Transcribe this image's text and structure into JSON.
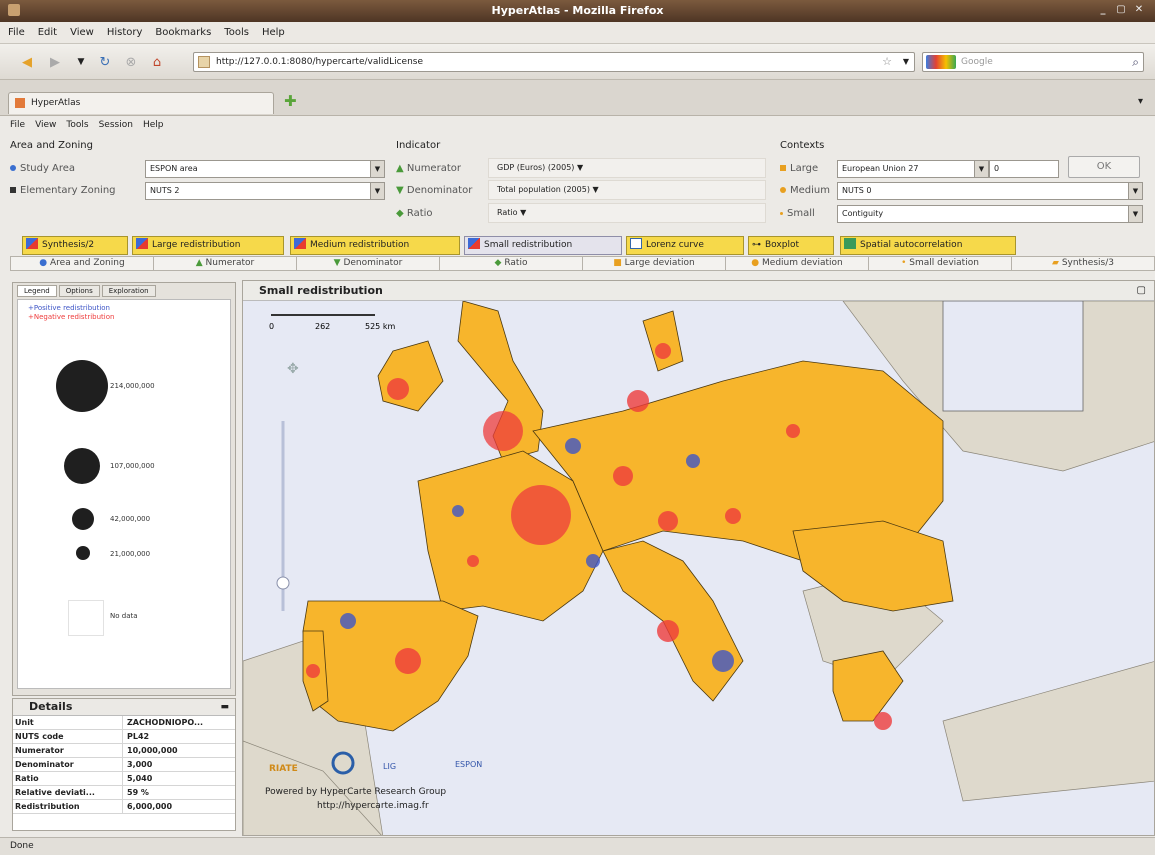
{
  "window": {
    "title": "HyperAtlas - Mozilla Firefox"
  },
  "browser_menu": [
    "File",
    "Edit",
    "View",
    "History",
    "Bookmarks",
    "Tools",
    "Help"
  ],
  "url": "http://127.0.0.1:8080/hypercarte/validLicense",
  "search": {
    "placeholder": "Google"
  },
  "tab": {
    "label": "HyperAtlas"
  },
  "app_menu": [
    "File",
    "View",
    "Tools",
    "Session",
    "Help"
  ],
  "area_zoning": {
    "title": "Area and Zoning",
    "study_area_label": "Study Area",
    "study_area_value": "ESPON area",
    "elementary_zoning_label": "Elementary Zoning",
    "elementary_zoning_value": "NUTS 2"
  },
  "indicator": {
    "title": "Indicator",
    "numerator_label": "Numerator",
    "numerator_value": "GDP (Euros) (2005) ▼",
    "denominator_label": "Denominator",
    "denominator_value": "Total population (2005) ▼",
    "ratio_label": "Ratio",
    "ratio_value": "Ratio ▼"
  },
  "contexts": {
    "title": "Contexts",
    "large_label": "Large",
    "large_value": "European Union 27",
    "large_param": "0",
    "medium_label": "Medium",
    "medium_value": "NUTS 0",
    "small_label": "Small",
    "small_value": "Contiguity",
    "ok_label": "OK"
  },
  "view_tabs": [
    "Synthesis/2",
    "Large redistribution",
    "Medium redistribution",
    "Small redistribution",
    "Lorenz curve",
    "Boxplot",
    "Spatial autocorrelation"
  ],
  "sub_tabs": [
    "Area and Zoning",
    "Numerator",
    "Denominator",
    "Ratio",
    "Large deviation",
    "Medium deviation",
    "Small deviation",
    "Synthesis/3"
  ],
  "left_tabs": [
    "Legend",
    "Options",
    "Exploration"
  ],
  "legend": {
    "positive": "+Positive redistribution",
    "negative": "+Negative redistribution",
    "values": [
      "214,000,000",
      "107,000,000",
      "42,000,000",
      "21,000,000"
    ],
    "no_data": "No data"
  },
  "details": {
    "title": "Details",
    "rows": [
      {
        "k": "Unit",
        "v": "ZACHODNIOPO..."
      },
      {
        "k": "NUTS code",
        "v": "PL42"
      },
      {
        "k": "Numerator",
        "v": "10,000,000"
      },
      {
        "k": "Denominator",
        "v": "3,000"
      },
      {
        "k": "Ratio",
        "v": "5,040"
      },
      {
        "k": "Relative deviati...",
        "v": "59 %"
      },
      {
        "k": "Redistribution",
        "v": "6,000,000"
      }
    ]
  },
  "map": {
    "title": "Small redistribution",
    "scale_labels": [
      "0",
      "262",
      "525 km"
    ],
    "logos": [
      "RIATE",
      "LIG",
      "ESPON"
    ],
    "credit_line1": "Powered by HyperCarte Research Group",
    "credit_line2": "http://hypercarte.imag.fr"
  },
  "status": {
    "text": "Done"
  },
  "colors": {
    "land": "#f7b52c",
    "sea": "#e6e9f4",
    "positive": "#3f56c7",
    "negative": "#ee3c3c",
    "nonstudy": "#ded9cc"
  }
}
